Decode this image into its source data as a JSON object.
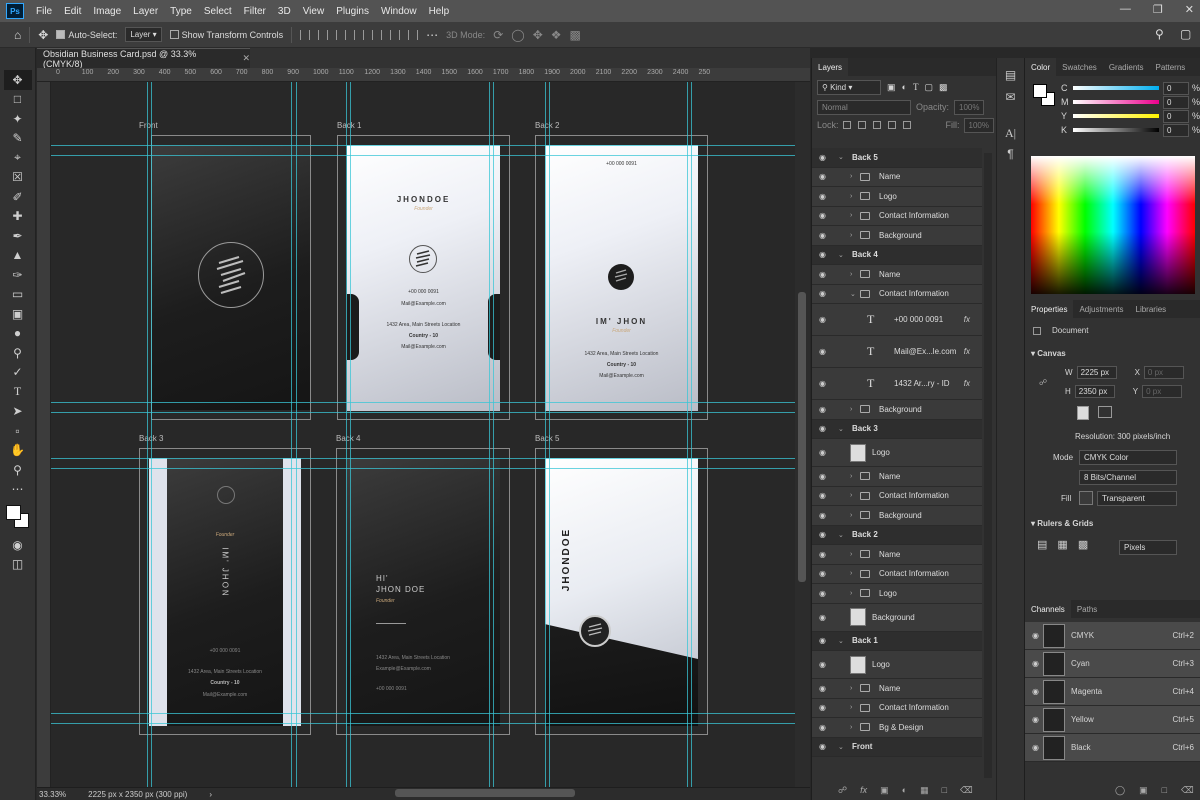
{
  "app": {
    "logo": "Ps",
    "menu": [
      "File",
      "Edit",
      "Image",
      "Layer",
      "Type",
      "Select",
      "Filter",
      "3D",
      "View",
      "Plugins",
      "Window",
      "Help"
    ]
  },
  "options_bar": {
    "auto_select_label": "Auto-Select:",
    "auto_select_value": "Layer",
    "show_transform_label": "Show Transform Controls",
    "mode_3d_label": "3D Mode:"
  },
  "document": {
    "tab_title": "Obsidian Business Card.psd @ 33.3% (CMYK/8)",
    "zoom": "33.33%",
    "doc_info": "2225 px x 2350 px (300 ppi)"
  },
  "rulers": {
    "h_ticks": [
      "0",
      "100",
      "200",
      "300",
      "400",
      "500",
      "600",
      "700",
      "800",
      "900",
      "1000",
      "1100",
      "1200",
      "1300",
      "1400",
      "1500",
      "1600",
      "1700",
      "1800",
      "1900",
      "2000",
      "2100",
      "2200",
      "2300",
      "2400",
      "250"
    ]
  },
  "artboards": [
    {
      "label": "Front"
    },
    {
      "label": "Back 1",
      "name": "JHONDOE",
      "title": "Founder",
      "phone": "+00 000 0091",
      "email": "Mail@Example.com",
      "address": "1432 Area, Main Streets Location",
      "country": "Country - 10",
      "email2": "Mail@Example.com"
    },
    {
      "label": "Back 2",
      "phone": "+00 000 0091",
      "name": "IM' JHON",
      "title": "Founder",
      "address": "1432 Area, Main Streets Location",
      "country": "Country - 10",
      "email": "Mail@Example.com"
    },
    {
      "label": "Back 3",
      "name": "IM' JHON",
      "title": "Founder",
      "phone": "+00 000 0091",
      "address": "1432 Area, Main Streets Location",
      "country": "Country - 10",
      "email": "Mail@Example.com"
    },
    {
      "label": "Back 4",
      "name1": "HI'",
      "name2": "JHON DOE",
      "title": "Founder",
      "address": "1432 Area, Main Streets Location",
      "email": "Example@Example.com",
      "phone": "+00 000 0091"
    },
    {
      "label": "Back 5",
      "name": "JHONDOE"
    }
  ],
  "layers_panel": {
    "tab": "Layers",
    "kind_label": "Kind",
    "blend_mode": "Normal",
    "opacity_label": "Opacity:",
    "opacity_value": "100%",
    "lock_label": "Lock:",
    "fill_label": "Fill:",
    "fill_value": "100%",
    "rows": [
      {
        "type": "group",
        "name": "Back 5",
        "open": true
      },
      {
        "type": "folder",
        "name": "Name"
      },
      {
        "type": "folder",
        "name": "Logo"
      },
      {
        "type": "folder",
        "name": "Contact Information"
      },
      {
        "type": "folder",
        "name": "Background"
      },
      {
        "type": "group",
        "name": "Back 4",
        "open": true
      },
      {
        "type": "folder",
        "name": "Name"
      },
      {
        "type": "folder",
        "name": "Contact Information",
        "open": true
      },
      {
        "type": "text",
        "name": "+00 000 0091",
        "fx": "fx"
      },
      {
        "type": "text",
        "name": "Mail@Ex...le.com",
        "fx": "fx"
      },
      {
        "type": "text",
        "name": "1432 Ar...ry - ID",
        "fx": "fx"
      },
      {
        "type": "folder",
        "name": "Background"
      },
      {
        "type": "group",
        "name": "Back 3",
        "open": true
      },
      {
        "type": "image",
        "name": "Logo"
      },
      {
        "type": "folder",
        "name": "Name"
      },
      {
        "type": "folder",
        "name": "Contact Information"
      },
      {
        "type": "folder",
        "name": "Background"
      },
      {
        "type": "group",
        "name": "Back 2",
        "open": true
      },
      {
        "type": "folder",
        "name": "Name"
      },
      {
        "type": "folder",
        "name": "Contact Information"
      },
      {
        "type": "folder",
        "name": "Logo"
      },
      {
        "type": "image",
        "name": "Background"
      },
      {
        "type": "group",
        "name": "Back 1",
        "open": true
      },
      {
        "type": "image",
        "name": "Logo"
      },
      {
        "type": "folder",
        "name": "Name"
      },
      {
        "type": "folder",
        "name": "Contact Information"
      },
      {
        "type": "folder",
        "name": "Bg & Design"
      },
      {
        "type": "group",
        "name": "Front",
        "open": true
      }
    ]
  },
  "color_panel": {
    "tabs": [
      "Color",
      "Swatches",
      "Gradients",
      "Patterns"
    ],
    "sliders": [
      {
        "label": "C",
        "value": "0",
        "unit": "%"
      },
      {
        "label": "M",
        "value": "0",
        "unit": "%"
      },
      {
        "label": "Y",
        "value": "0",
        "unit": "%"
      },
      {
        "label": "K",
        "value": "0",
        "unit": "%"
      }
    ]
  },
  "properties_panel": {
    "tabs": [
      "Properties",
      "Adjustments",
      "Libraries"
    ],
    "doc_label": "Document",
    "canvas_title": "Canvas",
    "w_label": "W",
    "w_value": "2225 px",
    "x_label": "X",
    "x_value": "0 px",
    "h_label": "H",
    "h_value": "2350 px",
    "y_label": "Y",
    "y_value": "0 px",
    "resolution": "Resolution: 300 pixels/inch",
    "mode_label": "Mode",
    "mode_value": "CMYK Color",
    "bits_value": "8 Bits/Channel",
    "fill_label": "Fill",
    "fill_value": "Transparent",
    "rulers_title": "Rulers & Grids",
    "units_value": "Pixels"
  },
  "channels_panel": {
    "tabs": [
      "Channels",
      "Paths"
    ],
    "rows": [
      {
        "name": "CMYK",
        "shortcut": "Ctrl+2"
      },
      {
        "name": "Cyan",
        "shortcut": "Ctrl+3"
      },
      {
        "name": "Magenta",
        "shortcut": "Ctrl+4"
      },
      {
        "name": "Yellow",
        "shortcut": "Ctrl+5"
      },
      {
        "name": "Black",
        "shortcut": "Ctrl+6"
      }
    ]
  },
  "colors": {
    "guide": "#39c6d6",
    "accent": "#31a8ff"
  }
}
